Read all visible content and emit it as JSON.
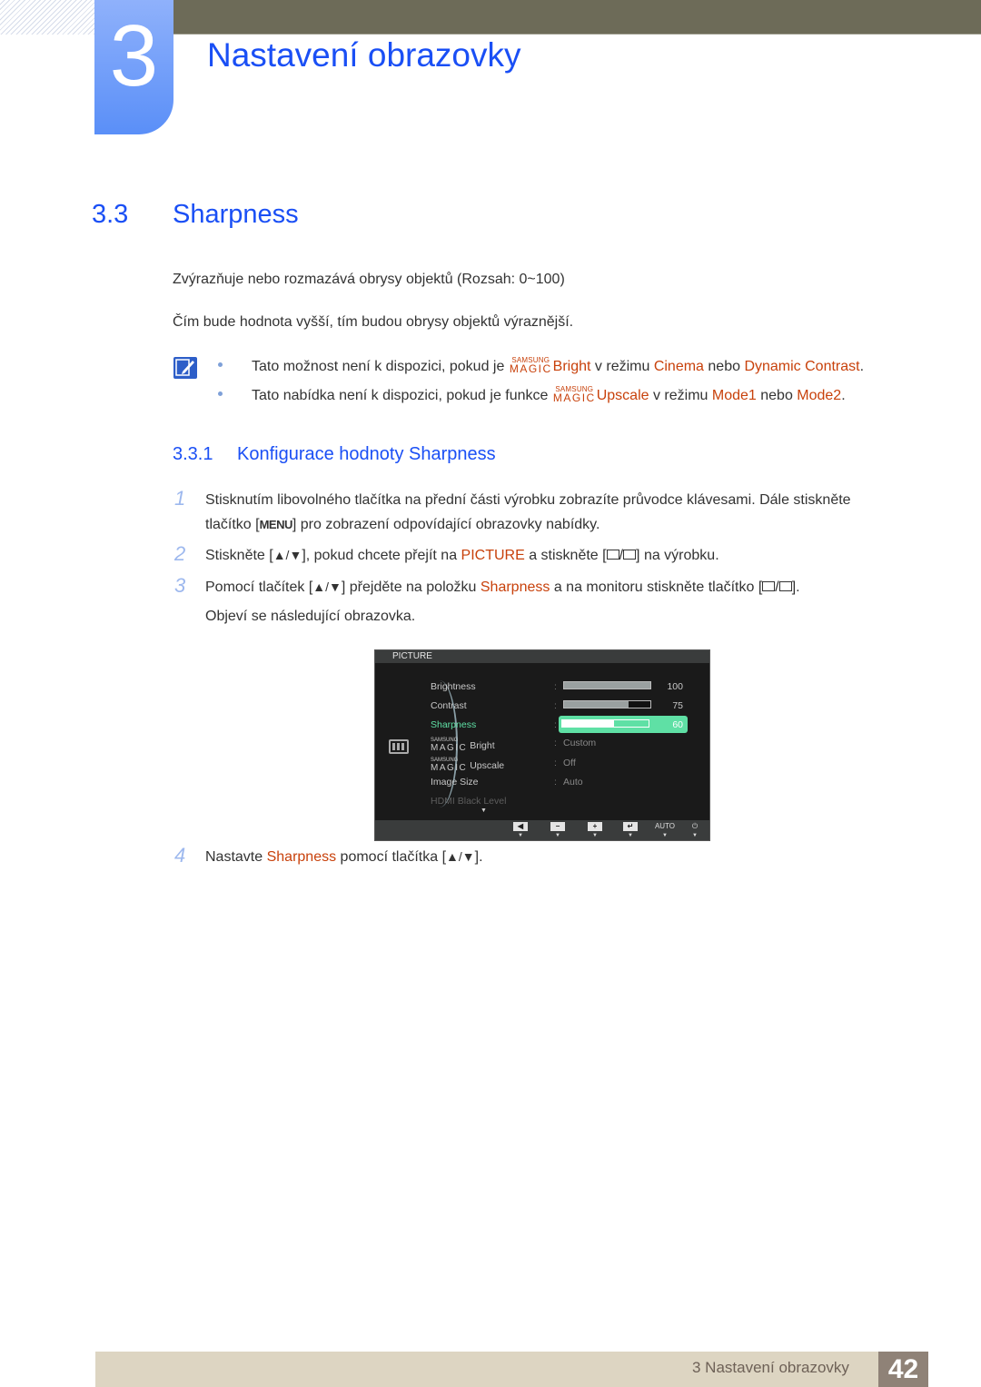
{
  "chapter": {
    "number": "3",
    "title": "Nastavení obrazovky"
  },
  "section": {
    "number": "3.3",
    "title": "Sharpness"
  },
  "paragraphs": [
    "Zvýrazňuje nebo rozmazává obrysy objektů (Rozsah: 0~100)",
    "Čím bude hodnota vyšší, tím budou obrysy objektů výraznější."
  ],
  "note": {
    "icon": "note-pencil-icon",
    "items": [
      {
        "pre": "Tato možnost není k dispozici, pokud je ",
        "magic_top": "SAMSUNG",
        "magic_bottom": "MAGIC",
        "feature": "Bright",
        "mid": " v režimu ",
        "opt1": "Cinema",
        "conj": " nebo ",
        "opt2": "Dynamic Contrast",
        "end": "."
      },
      {
        "pre": "Tato nabídka není k dispozici, pokud je funkce ",
        "magic_top": "SAMSUNG",
        "magic_bottom": "MAGIC",
        "feature": "Upscale",
        "mid": " v režimu ",
        "opt1": "Mode1",
        "conj": " nebo ",
        "opt2": "Mode2",
        "end": "."
      }
    ]
  },
  "subsection": {
    "number": "3.3.1",
    "title": "Konfigurace hodnoty Sharpness"
  },
  "steps": [
    {
      "num": "1",
      "line1": "Stisknutím libovolného tlačítka na přední části výrobku zobrazíte průvodce klávesami. Dále stiskněte",
      "line2_pre": "tlačítko [",
      "key": "MENU",
      "line2_post": "] pro zobrazení odpovídající obrazovky nabídky."
    },
    {
      "num": "2",
      "pre": "Stiskněte [",
      "arrows": "▲/▼",
      "mid1": "], pokud chcete přejít na ",
      "hl": "PICTURE",
      "mid2": " a stiskněte [",
      "enter": "/",
      "post": "] na výrobku."
    },
    {
      "num": "3",
      "pre": "Pomocí tlačítek [",
      "arrows": "▲/▼",
      "mid1": "] přejděte na položku ",
      "hl": "Sharpness",
      "mid2": " a na monitoru stiskněte tlačítko [",
      "enter": "/",
      "post": "].",
      "line2": "Objeví se následující obrazovka."
    },
    {
      "num": "4",
      "pre": "Nastavte ",
      "hl": "Sharpness",
      "mid": " pomocí tlačítka [",
      "arrows": "▲/▼",
      "post": "]."
    }
  ],
  "osd": {
    "title": "PICTURE",
    "rows": [
      {
        "label": "Brightness",
        "value": "100",
        "fill": 1.0
      },
      {
        "label": "Contrast",
        "value": "75",
        "fill": 0.75
      },
      {
        "label": "Sharpness",
        "value": "60",
        "fill": 0.6,
        "selected": true
      },
      {
        "magic_top": "SAMSUNG",
        "magic_bottom": "MAGIC",
        "label": "Bright",
        "value": "Custom"
      },
      {
        "magic_top": "SAMSUNG",
        "magic_bottom": "MAGIC",
        "label": "Upscale",
        "value": "Off"
      },
      {
        "label": "Image Size",
        "value": "Auto"
      },
      {
        "label": "HDMI Black Level",
        "value": ""
      }
    ],
    "more_indicator": "▼",
    "buttons": [
      {
        "name": "left-icon",
        "glyph": "◀"
      },
      {
        "name": "minus-icon",
        "glyph": "−"
      },
      {
        "name": "plus-icon",
        "glyph": "+"
      },
      {
        "name": "enter-icon",
        "glyph": "↵"
      },
      {
        "name": "auto",
        "glyph": "AUTO"
      },
      {
        "name": "power-icon",
        "glyph": "⏻"
      }
    ]
  },
  "footer": {
    "label": "3 Nastavení obrazovky",
    "page": "42"
  }
}
